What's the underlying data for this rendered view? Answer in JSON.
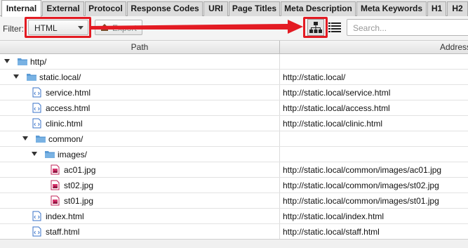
{
  "tabs": [
    {
      "label": "Internal",
      "active": true
    },
    {
      "label": "External"
    },
    {
      "label": "Protocol"
    },
    {
      "label": "Response Codes"
    },
    {
      "label": "URI"
    },
    {
      "label": "Page Titles"
    },
    {
      "label": "Meta Description"
    },
    {
      "label": "Meta Keywords"
    },
    {
      "label": "H1"
    },
    {
      "label": "H2"
    }
  ],
  "toolbar": {
    "filter_label": "Filter:",
    "filter_value": "HTML",
    "export_label": "Export",
    "search_placeholder": "Search..."
  },
  "icons": {
    "tree_view": "sitemap-icon",
    "list_view": "list-icon",
    "folder": "folder-icon",
    "html_file": "html-file-icon",
    "image_file": "image-file-icon"
  },
  "colors": {
    "highlight": "#e31b23",
    "folder": "#5b9bd5"
  },
  "table": {
    "columns": [
      "Path",
      "Address"
    ],
    "rows": [
      {
        "name": "http/",
        "address": "",
        "type": "folder",
        "level": 0,
        "expanded": true
      },
      {
        "name": "static.local/",
        "address": "http://static.local/",
        "type": "folder",
        "level": 1,
        "expanded": true
      },
      {
        "name": "service.html",
        "address": "http://static.local/service.html",
        "type": "html",
        "level": 2
      },
      {
        "name": "access.html",
        "address": "http://static.local/access.html",
        "type": "html",
        "level": 2
      },
      {
        "name": "clinic.html",
        "address": "http://static.local/clinic.html",
        "type": "html",
        "level": 2
      },
      {
        "name": "common/",
        "address": "",
        "type": "folder",
        "level": 2,
        "expanded": true
      },
      {
        "name": "images/",
        "address": "",
        "type": "folder",
        "level": 3,
        "expanded": true
      },
      {
        "name": "ac01.jpg",
        "address": "http://static.local/common/images/ac01.jpg",
        "type": "image",
        "level": 4
      },
      {
        "name": "st02.jpg",
        "address": "http://static.local/common/images/st02.jpg",
        "type": "image",
        "level": 4
      },
      {
        "name": "st01.jpg",
        "address": "http://static.local/common/images/st01.jpg",
        "type": "image",
        "level": 4
      },
      {
        "name": "index.html",
        "address": "http://static.local/index.html",
        "type": "html",
        "level": 2
      },
      {
        "name": "staff.html",
        "address": "http://static.local/staff.html",
        "type": "html",
        "level": 2
      }
    ]
  }
}
